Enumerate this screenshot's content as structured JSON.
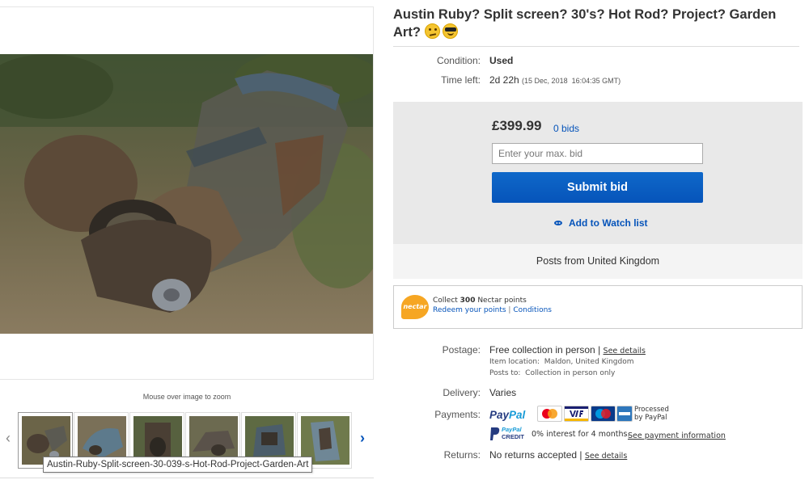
{
  "gallery": {
    "zoom_hint": "Mouse over image to zoom",
    "tooltip": "Austin-Ruby-Split-screen-30-039-s-Hot-Rod-Project-Garden-Art",
    "prev_arrow": "‹",
    "next_arrow": "›",
    "thumbnail_count": 6
  },
  "listing": {
    "title": "Austin Ruby? Split screen? 30's? Hot Rod? Project? Garden Art?",
    "title_emojis": [
      "confused-face-emoji",
      "sunglasses-face-emoji"
    ],
    "condition_label": "Condition:",
    "condition_value": "Used",
    "time_left_label": "Time left:",
    "time_left_value": "2d 22h",
    "time_left_end": "(15 Dec, 2018  16:04:35 GMT)"
  },
  "bidding": {
    "price": "£399.99",
    "bids": "0 bids",
    "input_placeholder": "Enter your max. bid",
    "submit_label": "Submit bid",
    "watch_label": "Add to Watch list",
    "posts_from": "Posts from United Kingdom"
  },
  "nectar": {
    "logo_text": "nectar",
    "line1_prefix": "Collect ",
    "line1_points": "300",
    "line1_suffix": " Nectar points",
    "redeem_link": "Redeem your points",
    "separator": "|",
    "conditions_link": "Conditions"
  },
  "postage": {
    "label": "Postage:",
    "value": "Free collection in person",
    "separator": "|",
    "see_details": "See details",
    "item_location": "Item location:  Maldon, United Kingdom",
    "posts_to": "Posts to:  Collection in person only"
  },
  "delivery": {
    "label": "Delivery:",
    "value": "Varies"
  },
  "payments": {
    "label": "Payments:",
    "paypal_part1": "Pay",
    "paypal_part2": "Pal",
    "cards": [
      "mastercard-icon",
      "visa-icon",
      "maestro-icon",
      "amex-icon"
    ],
    "processed_line1": "Processed",
    "processed_line2": "by PayPal",
    "credit_line1": "PayPal",
    "credit_line2": "CREDIT",
    "credit_text": "0% interest for 4 months.",
    "credit_link": "See payment information"
  },
  "returns": {
    "label": "Returns:",
    "value": "No returns accepted",
    "separator": "|",
    "see_details": "See details"
  },
  "colors": {
    "link_blue": "#0654ba",
    "button_blue": "#0654ba",
    "bid_box_bg": "#e9e9e9",
    "nectar_orange": "#f6a623"
  }
}
